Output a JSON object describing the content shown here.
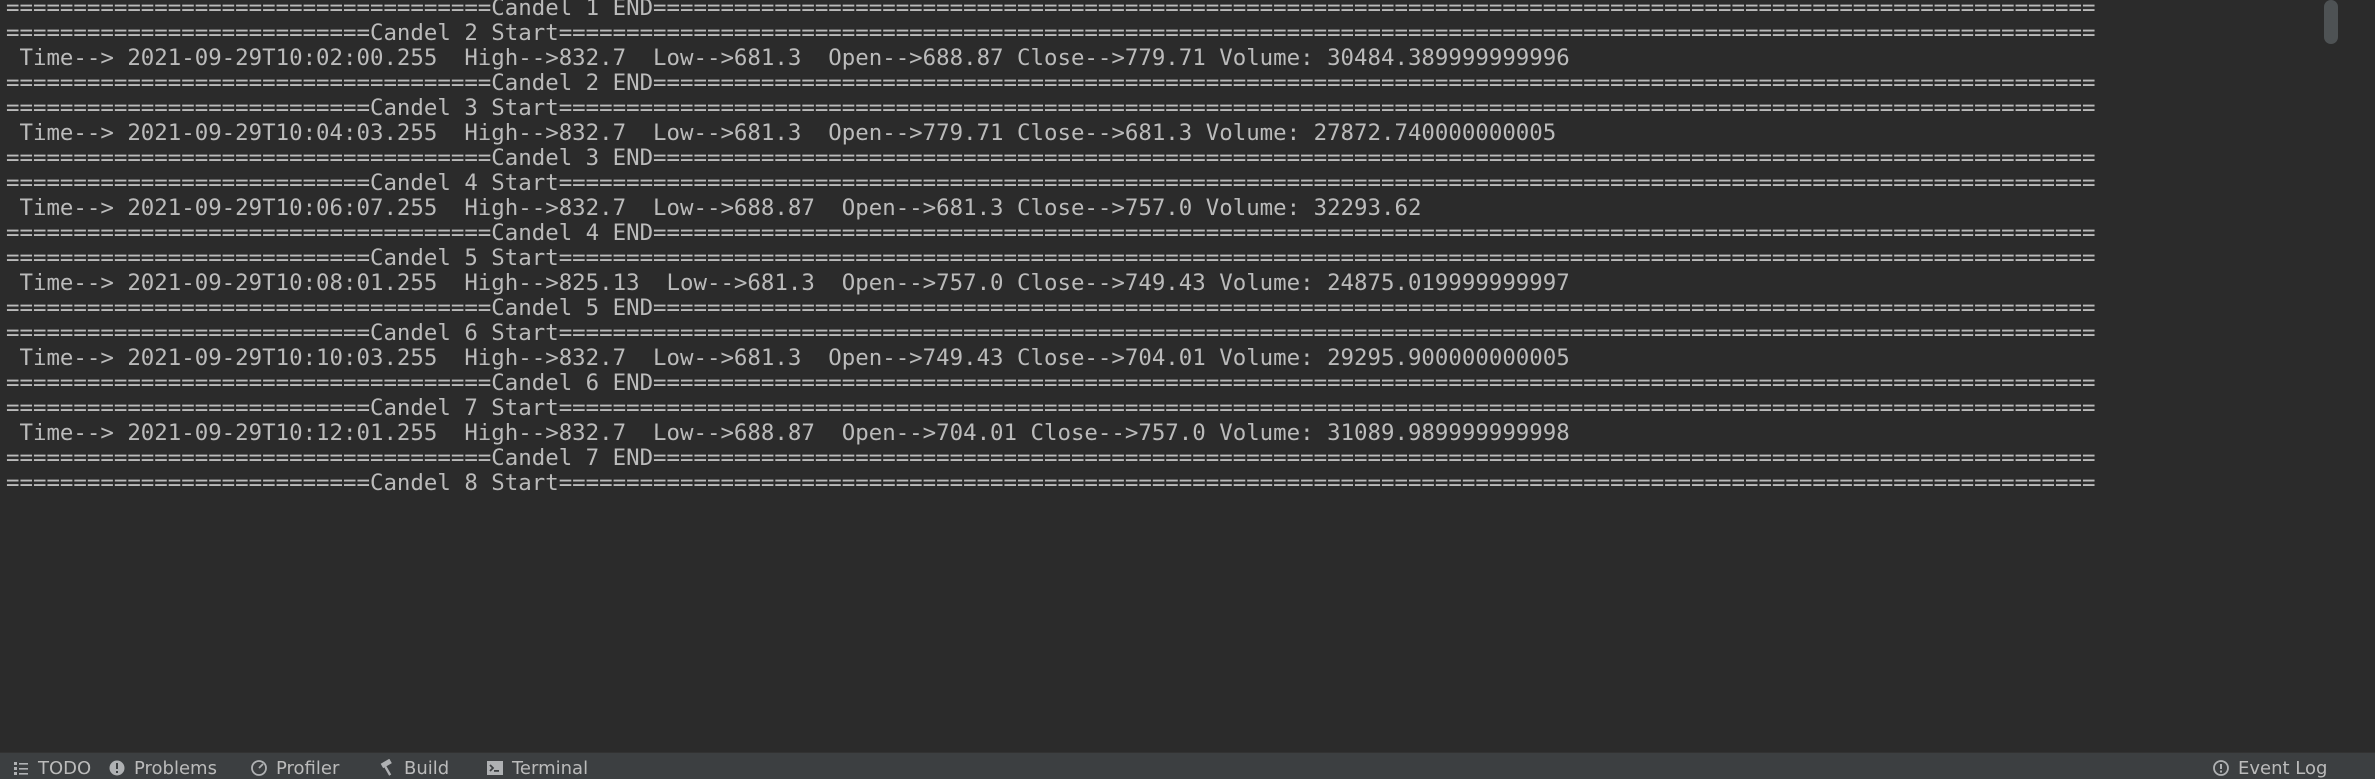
{
  "console": {
    "lines": [
      "====================================Candel 1 END===========================================================================================================",
      "===========================Candel 2 Start==================================================================================================================",
      " Time--> 2021-09-29T10:02:00.255  High-->832.7  Low-->681.3  Open-->688.87 Close-->779.71 Volume: 30484.389999999996",
      "====================================Candel 2 END===========================================================================================================",
      "===========================Candel 3 Start==================================================================================================================",
      " Time--> 2021-09-29T10:04:03.255  High-->832.7  Low-->681.3  Open-->779.71 Close-->681.3 Volume: 27872.740000000005",
      "====================================Candel 3 END===========================================================================================================",
      "===========================Candel 4 Start==================================================================================================================",
      " Time--> 2021-09-29T10:06:07.255  High-->832.7  Low-->688.87  Open-->681.3 Close-->757.0 Volume: 32293.62",
      "====================================Candel 4 END===========================================================================================================",
      "===========================Candel 5 Start==================================================================================================================",
      " Time--> 2021-09-29T10:08:01.255  High-->825.13  Low-->681.3  Open-->757.0 Close-->749.43 Volume: 24875.019999999997",
      "====================================Candel 5 END===========================================================================================================",
      "===========================Candel 6 Start==================================================================================================================",
      " Time--> 2021-09-29T10:10:03.255  High-->832.7  Low-->681.3  Open-->749.43 Close-->704.01 Volume: 29295.900000000005",
      "====================================Candel 6 END===========================================================================================================",
      "===========================Candel 7 Start==================================================================================================================",
      " Time--> 2021-09-29T10:12:01.255  High-->832.7  Low-->688.87  Open-->704.01 Close-->757.0 Volume: 31089.989999999998",
      "====================================Candel 7 END===========================================================================================================",
      "===========================Candel 8 Start=================================================================================================================="
    ]
  },
  "toolwindow_bar": {
    "items": [
      {
        "label": "TODO",
        "icon": "list-icon"
      },
      {
        "label": "Problems",
        "icon": "warning-circle-icon"
      },
      {
        "label": "Profiler",
        "icon": "gauge-icon"
      },
      {
        "label": "Build",
        "icon": "hammer-icon"
      },
      {
        "label": "Terminal",
        "icon": "terminal-icon"
      },
      {
        "label": "Event Log",
        "icon": "event-log-icon"
      }
    ]
  },
  "colors": {
    "background": "#2b2b2b",
    "console_text": "#bbbbbb",
    "toolbar_background": "#3c3f41",
    "scrollbar_thumb": "#4e5254"
  }
}
